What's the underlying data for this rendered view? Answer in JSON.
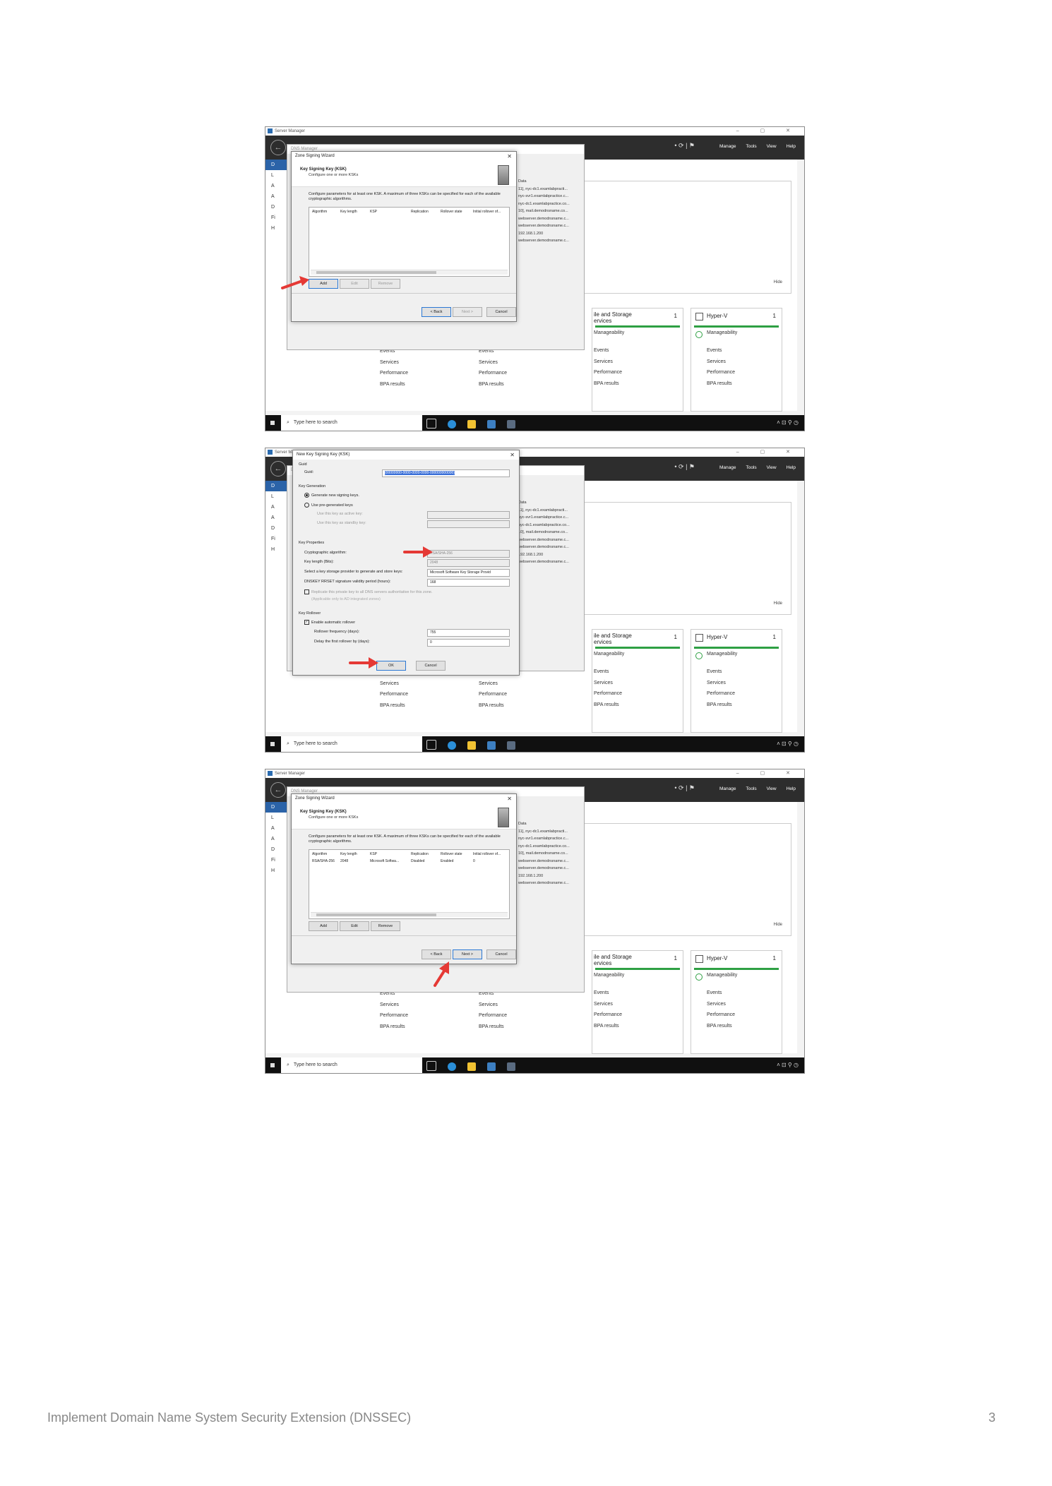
{
  "server_manager": {
    "title": "Server Manager",
    "inner_window_title": "DNS Manager",
    "menu": [
      "Manage",
      "Tools",
      "View",
      "Help"
    ],
    "sidebar_initials": [
      "D",
      "L",
      "A",
      "A",
      "D",
      "Fi",
      "H"
    ],
    "background_list": [
      "Data",
      "11], nyc-dc1.examlabpracti...",
      "nyc-svr1.examlabpractice.c...",
      "nyc-dc1.examlabpractice.co...",
      "10], mail.demodnsname.co...",
      "webserver.demodnsname.c...",
      "webserver.demodnsname.c...",
      "192.168.1.200",
      "webserver.demodnsname.c..."
    ],
    "hide_label": "Hide",
    "tiles": [
      {
        "name": "ile and Storage\nervices",
        "count": "1",
        "lines": [
          "Manageability",
          "Events",
          "Services",
          "Performance",
          "BPA results"
        ]
      },
      {
        "name": "Hyper-V",
        "count": "1",
        "lines": [
          "Manageability",
          "Events",
          "Services",
          "Performance",
          "BPA results"
        ]
      }
    ],
    "columns": [
      [
        "Events",
        "Services",
        "Performance",
        "BPA results"
      ],
      [
        "Events",
        "Services",
        "Performance",
        "BPA results"
      ]
    ],
    "taskbar": {
      "search_placeholder": "Type here to search"
    }
  },
  "wizard": {
    "title": "Zone Signing Wizard",
    "heading": "Key Signing Key (KSK)",
    "subheading": "Configure one or more KSKs",
    "description": "Configure parameters for at least one KSK. A maximum of three KSKs can be specified for each of the available cryptographic algorithms.",
    "columns": [
      "Algorithm",
      "Key length",
      "KSP",
      "Replication",
      "Rollover state",
      "Initial rollover of..."
    ],
    "row": [
      "RSA/SHA-256",
      "2048",
      "Microsoft Softwa...",
      "Disabled",
      "Enabled",
      "0"
    ],
    "buttons": {
      "add": "Add",
      "edit": "Edit",
      "remove": "Remove",
      "back": "< Back",
      "next": "Next >",
      "cancel": "Cancel"
    }
  },
  "ksk_dialog": {
    "title": "New Key Signing Key (KSK)",
    "guid_group": "Guid",
    "guid_label": "Guid:",
    "guid_value": "{00000000-0000-0000-0000-000000000000}",
    "key_generation": "Key Generation",
    "generate_new": "Generate new signing keys.",
    "use_pregenerated": "Use pre-generated keys",
    "use_active": "Use this key as active key:",
    "use_standby": "Use this key as standby key:",
    "key_properties": "Key Properties",
    "crypto_label": "Cryptographic algorithm:",
    "crypto_value": "RSA/SHA-256",
    "keylen_label": "Key length (Bits):",
    "keylen_value": "2048",
    "ksp_label": "Select a key storage provider to generate and store keys:",
    "ksp_value": "Microsoft Software Key Storage Provid",
    "validity_label": "DNSKEY RRSET signature validity period (hours):",
    "validity_value": "168",
    "replicate_label": "Replicate this private key to all DNS servers authoritative for this zone.",
    "replicate_note": "(Applicable only to AD integrated zones)",
    "key_rollover": "Key Rollover",
    "enable_rollover": "Enable automatic rollover",
    "rollover_freq_label": "Rollover frequency (days):",
    "rollover_freq_value": "755",
    "delay_label": "Delay the first rollover by (days):",
    "delay_value": "0",
    "ok": "OK",
    "cancel": "Cancel"
  },
  "footer": {
    "title": "Implement Domain Name System Security Extension (DNSSEC)",
    "page": "3"
  },
  "colors": {
    "accent": "#2b63a8",
    "arrow": "#e53935",
    "manageability_green": "#2ea043"
  }
}
